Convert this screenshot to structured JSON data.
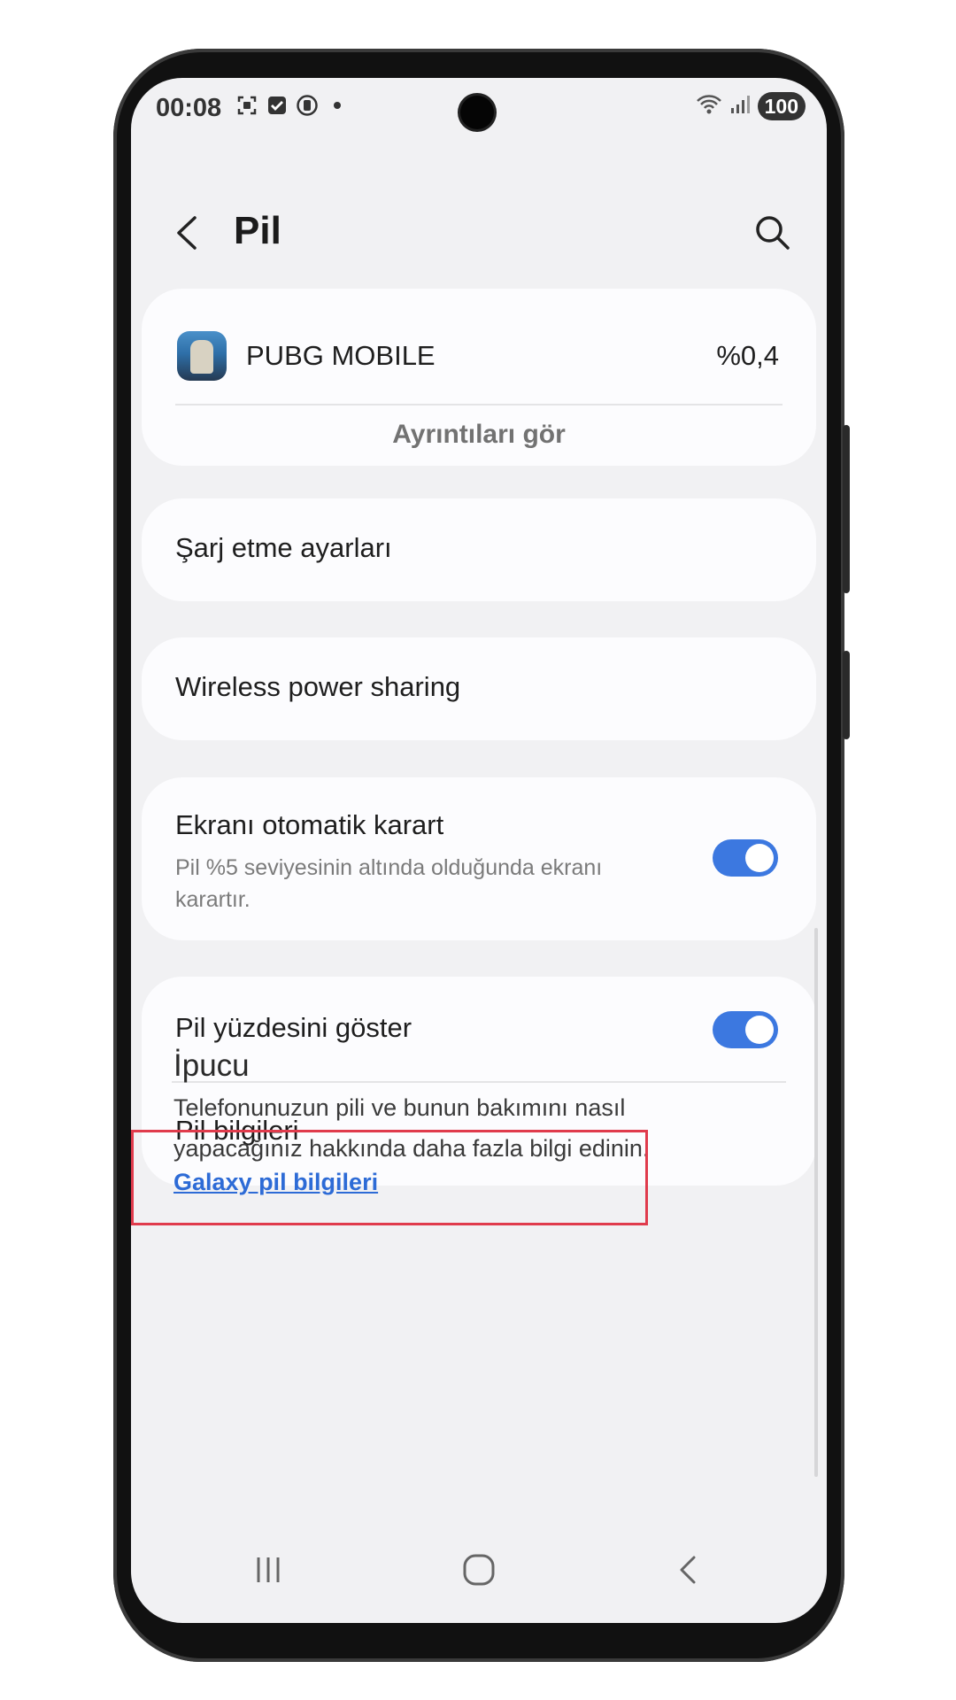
{
  "status": {
    "time": "00:08",
    "battery": "100",
    "icons_left": [
      "screenshot-icon",
      "check-box-icon",
      "data-saver-icon",
      "dot-icon"
    ],
    "icons_right": [
      "wifi-icon",
      "signal-icon"
    ]
  },
  "header": {
    "title": "Pil",
    "back_icon": "chevron-left-icon",
    "search_icon": "search-icon"
  },
  "app_usage": {
    "app_name": "PUBG MOBILE",
    "percent": "%0,4",
    "details_label": "Ayrıntıları gör"
  },
  "items": {
    "charging": "Şarj etme ayarları",
    "wireless": "Wireless power sharing",
    "auto_dim": {
      "title": "Ekranı otomatik karart",
      "subtitle_line1": "Pil %5 seviyesinin altında olduğunda ekranı",
      "subtitle_line2": "karartır.",
      "enabled": true
    },
    "show_percent": {
      "title": "Pil yüzdesini göster",
      "enabled": true
    },
    "battery_info": "Pil bilgileri"
  },
  "tip": {
    "title": "İpucu",
    "line1": "Telefonunuzun pili ve bunun bakımını nasıl",
    "line2": "yapacağınız hakkında daha fazla bilgi edinin.",
    "link": "Galaxy pil bilgileri"
  },
  "navbar": {
    "recents_icon": "recents-icon",
    "home_icon": "home-icon",
    "back_icon": "back-icon"
  },
  "colors": {
    "accent": "#3c78e0",
    "highlight": "#e03b4c",
    "link": "#2d6bd6"
  }
}
